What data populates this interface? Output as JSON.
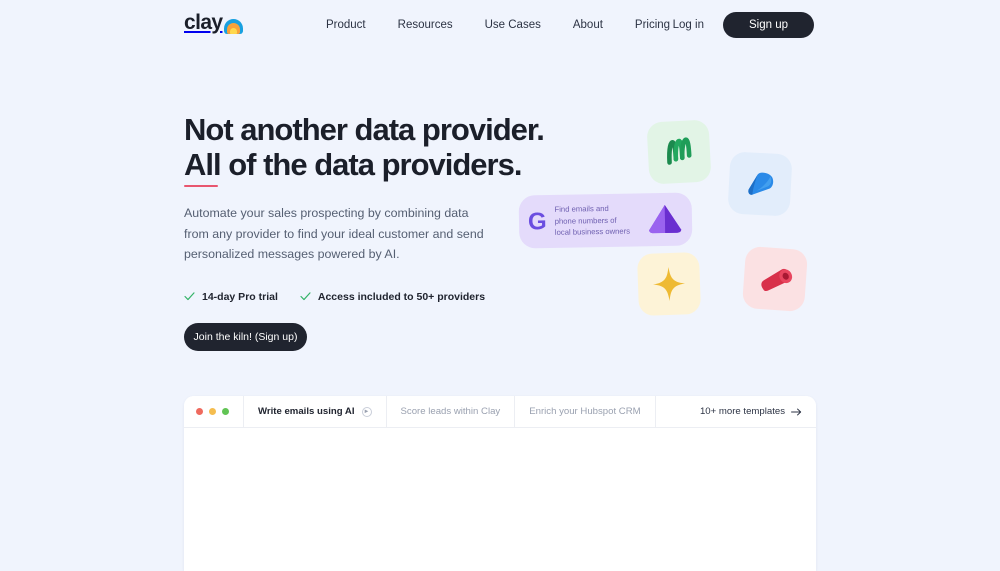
{
  "brand": {
    "logo_text": "clay",
    "accent_red": "#e8566f",
    "dark": "#20242f",
    "background": "#f0f4fd"
  },
  "header": {
    "nav": [
      {
        "label": "Product"
      },
      {
        "label": "Resources"
      },
      {
        "label": "Use Cases"
      },
      {
        "label": "About"
      },
      {
        "label": "Pricing"
      }
    ],
    "login_label": "Log in",
    "signup_label": "Sign up"
  },
  "hero": {
    "headline_line1": "Not another data provider.",
    "headline_line2_underlined": "All",
    "headline_line2_rest": " of the data providers.",
    "subheadline": "Automate your sales prospecting by combining data from any provider to find your ideal customer and send personalized messages powered by AI.",
    "features": [
      {
        "label": "14-day Pro trial",
        "icon": "check-icon"
      },
      {
        "label": "Access included to 50+ providers",
        "icon": "check-icon"
      }
    ],
    "cta_label": "Join the kiln! (Sign up)"
  },
  "floating_cards": [
    {
      "name": "green-squiggle-card",
      "icon": "clay-m-squiggle-icon",
      "bg": "#e2f4e6",
      "shape_color": "#1f9d58"
    },
    {
      "name": "blue-cone-card",
      "icon": "clay-cone-icon",
      "bg": "#e2edfb",
      "shape_color": "#2a8ae8"
    },
    {
      "name": "gold-sparkle-card",
      "icon": "clay-sparkle-icon",
      "bg": "#fdf3d7",
      "shape_color": "#e8b82f"
    },
    {
      "name": "red-cylinder-card",
      "icon": "clay-cylinder-icon",
      "bg": "#fbe1e3",
      "shape_color": "#d8304a"
    }
  ],
  "purple_card": {
    "logo": "G",
    "line1": "Find emails and",
    "line2": "phone numbers of",
    "line3": "local business owners",
    "icon": "clay-pyramid-icon",
    "bg": "#e4dbfb"
  },
  "panel": {
    "window_controls": [
      {
        "name": "close",
        "color": "#ef6a5e"
      },
      {
        "name": "minimize",
        "color": "#f5bd4f"
      },
      {
        "name": "maximize",
        "color": "#61c454"
      }
    ],
    "tabs": [
      {
        "label": "Write emails using AI",
        "active": true,
        "badge_icon": "play-circle-icon"
      },
      {
        "label": "Score leads within Clay",
        "active": false
      },
      {
        "label": "Enrich your Hubspot CRM",
        "active": false
      }
    ],
    "more_templates_label": "10+ more templates",
    "more_templates_icon": "arrow-right-icon"
  }
}
